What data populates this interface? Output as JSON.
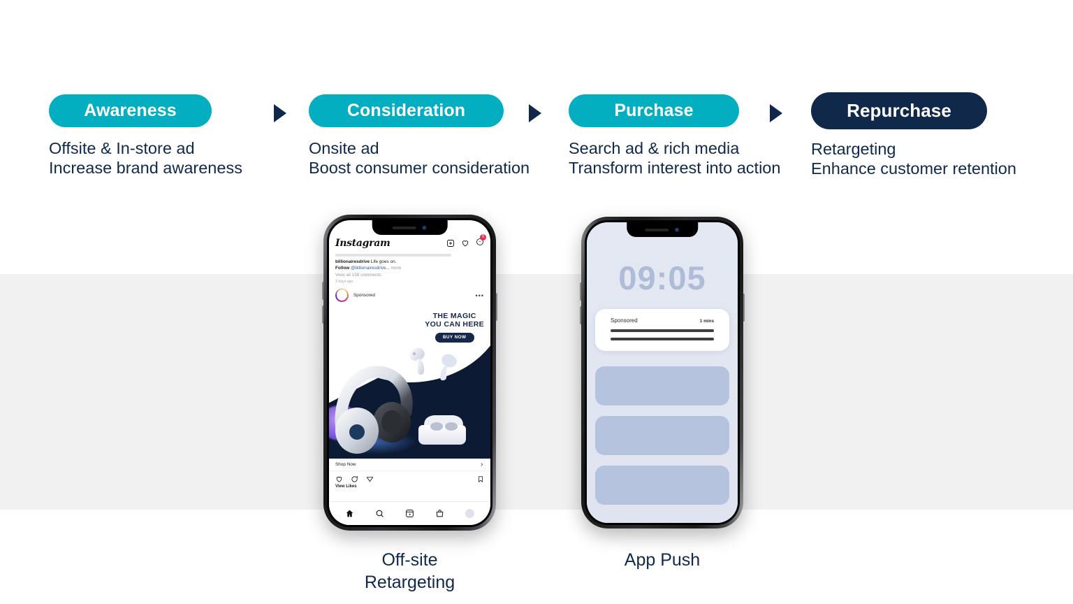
{
  "colors": {
    "teal": "#03aec0",
    "navy": "#10294b",
    "band_gray": "#f1f1f1",
    "lock_blue": "#e3e8f2",
    "card_blue": "#b6c3de",
    "badge_red": "#ed2c4b"
  },
  "funnel": {
    "arrow_icon": "triangle-right-icon",
    "stages": [
      {
        "label": "Awareness",
        "style": "teal",
        "desc_line1": "Offsite & In-store ad",
        "desc_line2": "Increase brand awareness"
      },
      {
        "label": "Consideration",
        "style": "teal",
        "desc_line1": "Onsite ad",
        "desc_line2": "Boost consumer consideration"
      },
      {
        "label": "Purchase",
        "style": "teal",
        "desc_line1": "Search ad & rich media",
        "desc_line2": "Transform interest into action"
      },
      {
        "label": "Repurchase",
        "style": "navy",
        "desc_line1": "Retargeting",
        "desc_line2": "Enhance customer retention"
      }
    ]
  },
  "phone_instagram": {
    "caption_label_line1": "Off-site",
    "caption_label_line2": "Retargeting",
    "app_name": "Instagram",
    "header_icons": [
      {
        "name": "plus-square-icon"
      },
      {
        "name": "heart-icon"
      },
      {
        "name": "messenger-icon",
        "badge": "9"
      }
    ],
    "post_caption": {
      "username": "billionairesdrive",
      "text": "Life goes on.",
      "follow_prefix": "Follow",
      "mention": "@billionairesdrive...",
      "more": "more",
      "comments": "View all 158 comments",
      "timestamp": "3 days ago"
    },
    "sponsored_label": "Sponsored",
    "more_menu_icon": "ellipsis-icon",
    "ad": {
      "headline_line1": "THE MAGIC",
      "headline_line2": "YOU CAN HERE",
      "cta_label": "BUY NOW",
      "product_icons": [
        "headphones-icon",
        "earbuds-icon",
        "charging-case-icon"
      ]
    },
    "shop_now_label": "Shop Now",
    "shop_chevron_icon": "chevron-right-icon",
    "action_icons": [
      "heart-icon",
      "comment-icon",
      "share-icon",
      "bookmark-icon"
    ],
    "view_likes_label": "View Likes",
    "nav_icons": [
      "home-icon",
      "search-icon",
      "reels-icon",
      "shop-bag-icon",
      "profile-avatar"
    ]
  },
  "phone_lockscreen": {
    "caption_label": "App Push",
    "clock": "09:05",
    "notification": {
      "title": "Sponsored",
      "time": "1 mins",
      "body_bars": 2
    },
    "placeholder_cards": 3
  }
}
